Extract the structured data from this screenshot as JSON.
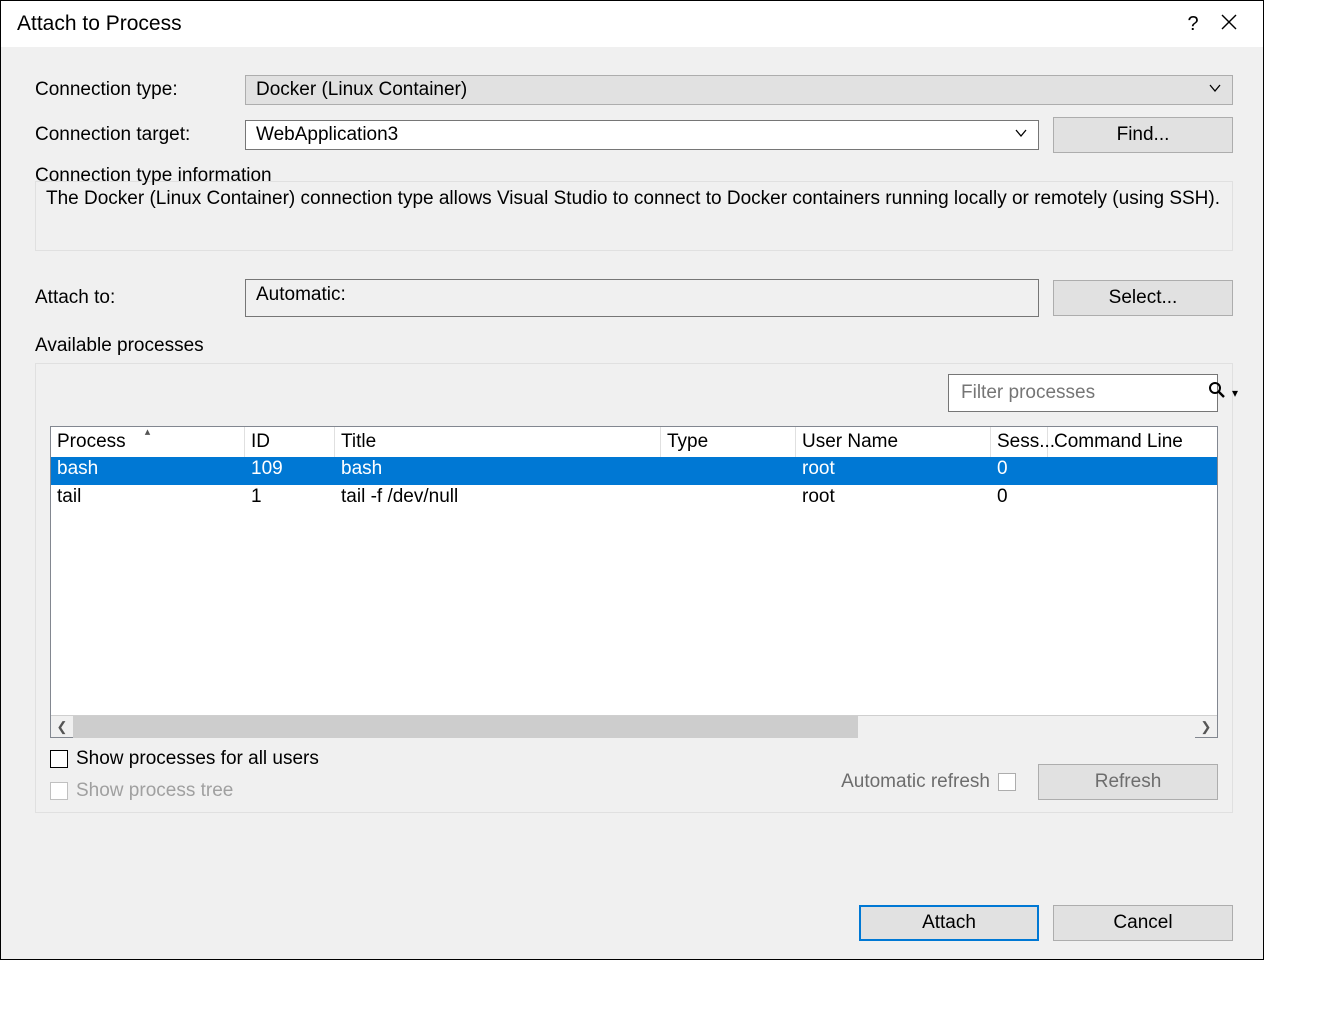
{
  "title": "Attach to Process",
  "labels": {
    "conn_type": "Connection type:",
    "conn_target": "Connection target:",
    "attach_to": "Attach to:",
    "available": "Available processes",
    "info_head": "Connection type information",
    "info_body": "The Docker (Linux Container) connection type allows Visual Studio to connect to Docker containers running locally or remotely (using SSH).",
    "show_all": "Show processes for all users",
    "show_tree": "Show process tree",
    "auto_refresh": "Automatic refresh"
  },
  "conn_type_value": "Docker (Linux Container)",
  "conn_target_value": "WebApplication3",
  "attach_to_value": "Automatic:",
  "filter_placeholder": "Filter processes",
  "buttons": {
    "find": "Find...",
    "select": "Select...",
    "refresh": "Refresh",
    "attach": "Attach",
    "cancel": "Cancel"
  },
  "columns": {
    "process": "Process",
    "id": "ID",
    "title": "Title",
    "type": "Type",
    "user": "User Name",
    "session": "Sess...",
    "cmd": "Command Line"
  },
  "rows": [
    {
      "process": "bash",
      "id": "109",
      "title": "bash",
      "type": "",
      "user": "root",
      "session": "0",
      "cmd": "",
      "selected": true
    },
    {
      "process": "tail",
      "id": "1",
      "title": "tail -f /dev/null",
      "type": "",
      "user": "root",
      "session": "0",
      "cmd": "",
      "selected": false
    }
  ]
}
